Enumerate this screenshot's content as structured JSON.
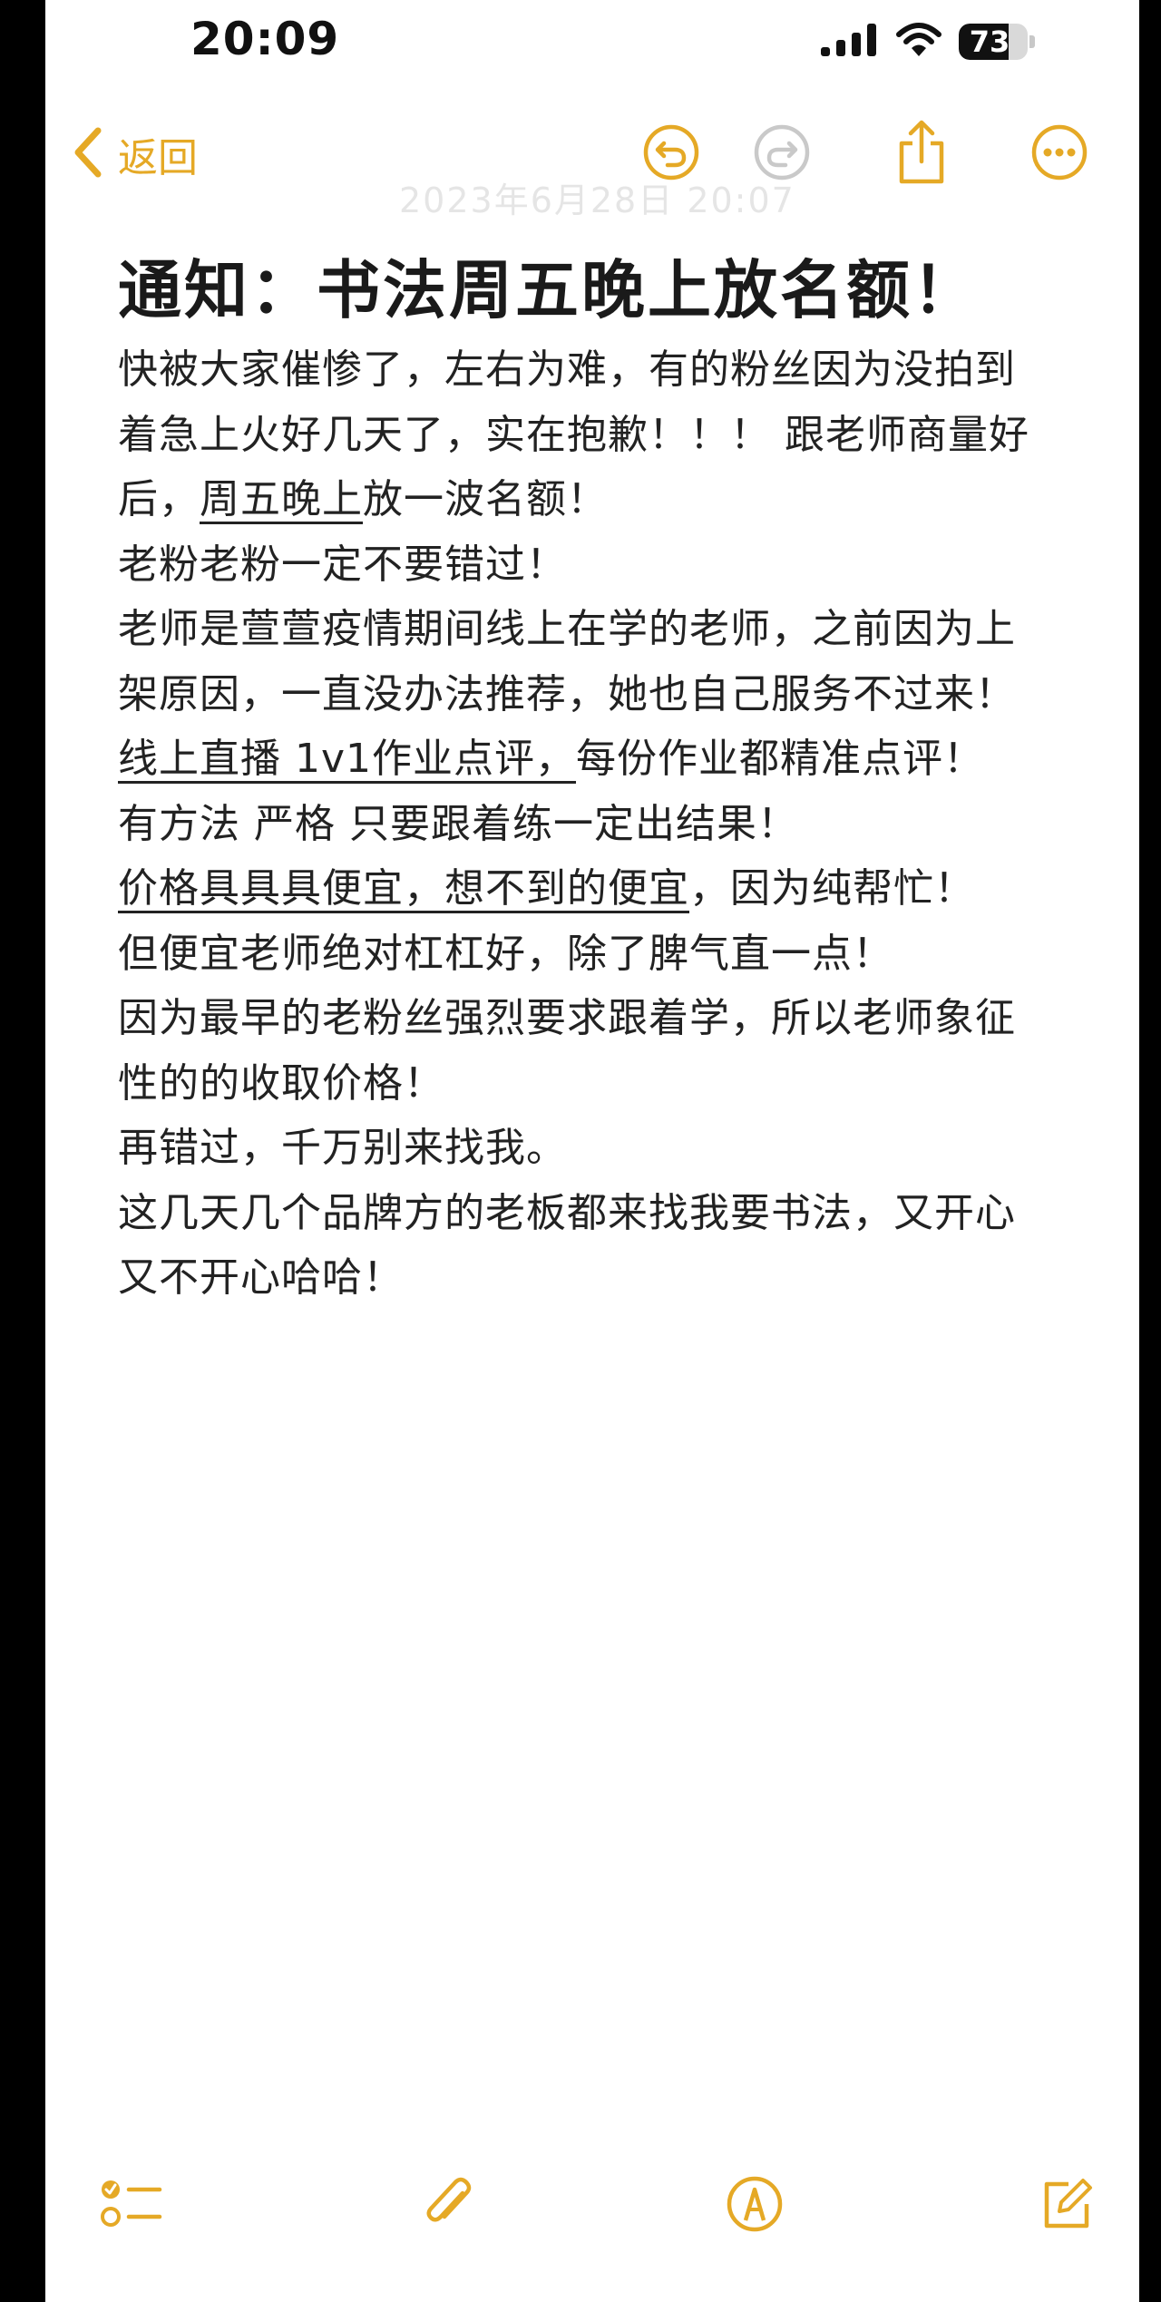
{
  "status_bar": {
    "time": "20:09",
    "battery_level": "73",
    "battery_fraction": 0.73,
    "icons": [
      "cellular-signal-icon",
      "wifi-icon",
      "battery-icon"
    ]
  },
  "nav": {
    "back_label": "返回",
    "icons": [
      "chevron-left-icon",
      "undo-icon",
      "redo-icon",
      "share-icon",
      "more-icon"
    ],
    "accent_color": "#e5a926",
    "disabled_color": "#c9c9c9",
    "faded_date": "2023年6月28日 20:07"
  },
  "note": {
    "title": "通知：书法周五晚上放名额！",
    "lines": [
      [
        {
          "t": "快被大家催惨了，左右为难，有的粉丝因为没拍到",
          "u": false
        }
      ],
      [
        {
          "t": "着急上火好几天了，实在抱歉！！！ 跟老师商量好",
          "u": false
        }
      ],
      [
        {
          "t": "后，",
          "u": false
        },
        {
          "t": "周五晚上",
          "u": true
        },
        {
          "t": "放一波名额！",
          "u": false
        }
      ],
      [
        {
          "t": "老粉老粉一定不要错过！",
          "u": false
        }
      ],
      [
        {
          "t": "老师是萱萱疫情期间线上在学的老师，之前因为上",
          "u": false
        }
      ],
      [
        {
          "t": "架原因，一直没办法推荐，她也自己服务不过来！",
          "u": false
        }
      ],
      [
        {
          "t": "线上直播 1v1作业点评，",
          "u": true
        },
        {
          "t": "每份作业都精准点评！",
          "u": false
        }
      ],
      [
        {
          "t": "有方法 严格 只要跟着练一定出结果！",
          "u": false
        }
      ],
      [
        {
          "t": "价格具具具便宜，想不到的便宜",
          "u": true
        },
        {
          "t": "，因为纯帮忙！",
          "u": false
        }
      ],
      [
        {
          "t": "但便宜老师绝对杠杠好，除了脾气直一点！",
          "u": false
        }
      ],
      [
        {
          "t": "因为最早的老粉丝强烈要求跟着学，所以老师象征",
          "u": false
        }
      ],
      [
        {
          "t": "性的的收取价格！",
          "u": false
        }
      ],
      [
        {
          "t": "再错过，千万别来找我。",
          "u": false
        }
      ],
      [
        {
          "t": "这几天几个品牌方的老板都来找我要书法，又开心",
          "u": false
        }
      ],
      [
        {
          "t": "又不开心哈哈！",
          "u": false
        }
      ]
    ]
  },
  "toolbar": {
    "icons": [
      "checklist-icon",
      "paperclip-icon",
      "markup-pen-icon",
      "compose-icon"
    ]
  }
}
